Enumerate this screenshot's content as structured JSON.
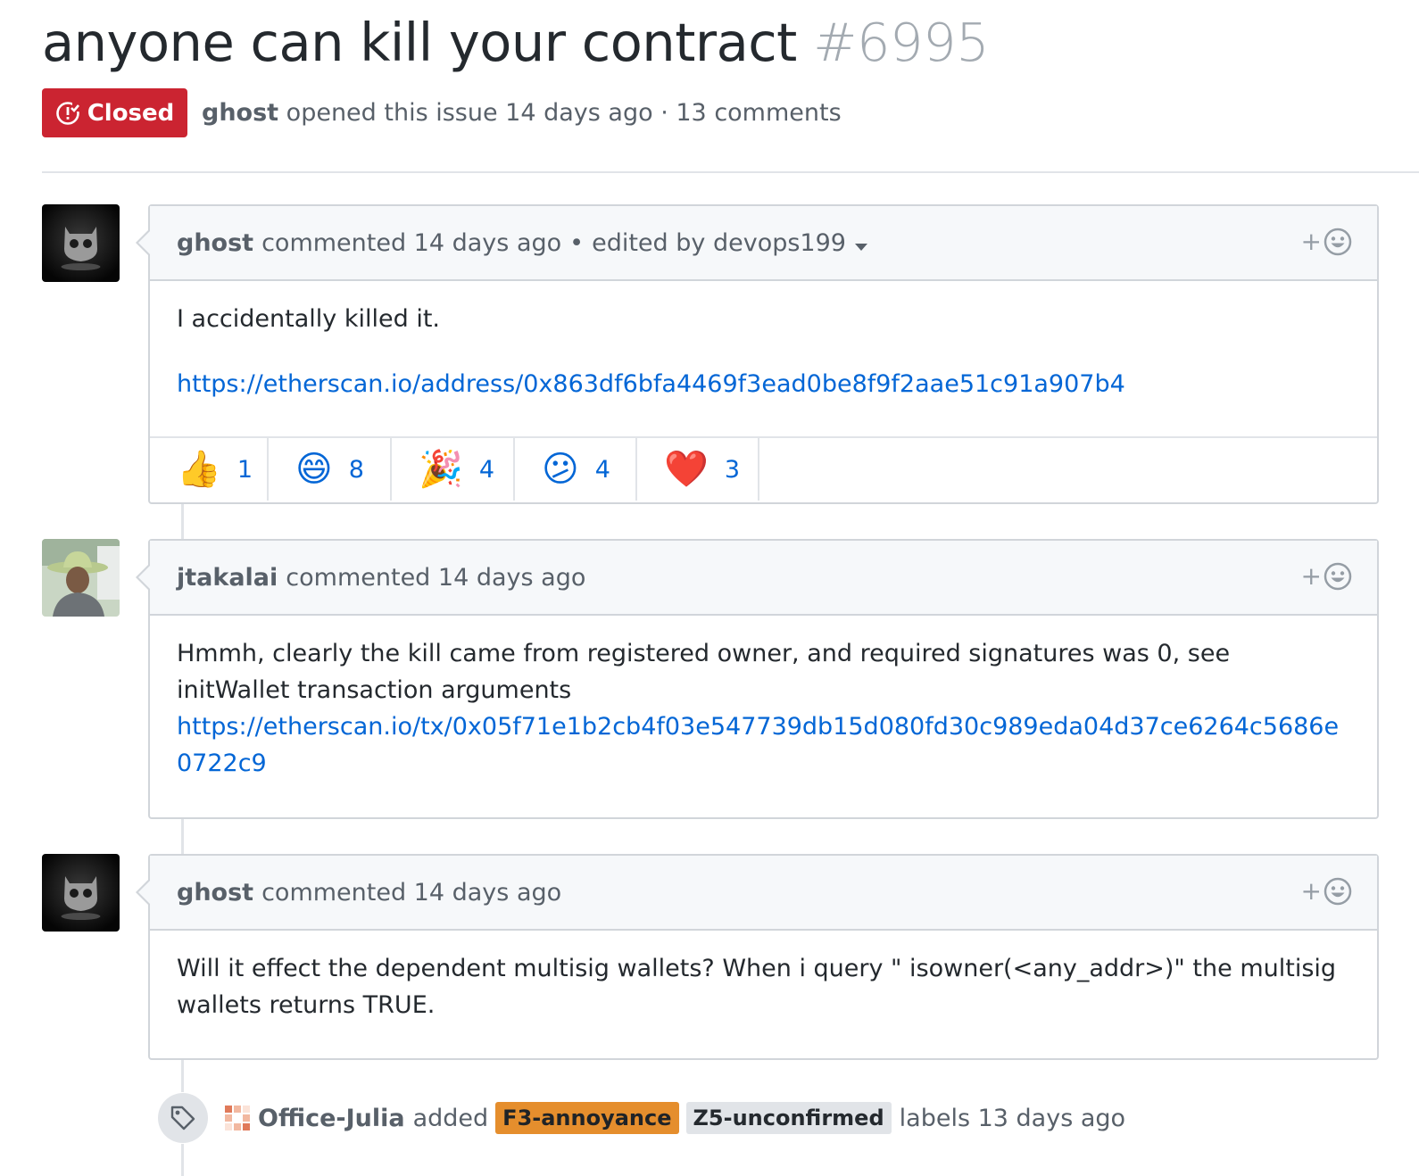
{
  "issue": {
    "title": "anyone can kill your contract",
    "number": "#6995",
    "state": "Closed",
    "author": "ghost",
    "opened_text": "opened this issue 14 days ago · 13 comments"
  },
  "comments": [
    {
      "author": "ghost",
      "meta": "commented 14 days ago",
      "edited": "edited by devops199",
      "body_text": "I accidentally killed it.",
      "link": "https://etherscan.io/address/0x863df6bfa4469f3ead0be8f9f2aae51c91a907b4",
      "reactions": [
        {
          "emoji": "👍",
          "name": "thumbs-up",
          "count": "1"
        },
        {
          "emoji": "😄",
          "name": "laugh",
          "count": "8"
        },
        {
          "emoji": "🎉",
          "name": "hooray",
          "count": "4"
        },
        {
          "emoji": "😕",
          "name": "confused",
          "count": "4"
        },
        {
          "emoji": "❤️",
          "name": "heart",
          "count": "3"
        }
      ]
    },
    {
      "author": "jtakalai",
      "meta": "commented 14 days ago",
      "body_text": "Hmmh, clearly the kill came from registered owner, and required signatures was 0, see initWallet transaction arguments",
      "link": "https://etherscan.io/tx/0x05f71e1b2cb4f03e547739db15d080fd30c989eda04d37ce6264c5686e0722c9"
    },
    {
      "author": "ghost",
      "meta": "commented 14 days ago",
      "body_text": "Will it effect the dependent multisig wallets? When i query \" isowner(<any_addr>)\" the multisig wallets returns TRUE."
    }
  ],
  "event": {
    "actor": "Office-Julia",
    "action": "added",
    "labels": [
      {
        "name": "F3-annoyance",
        "color": "#e58e2d"
      },
      {
        "name": "Z5-unconfirmed",
        "color": "#e1e4e8"
      }
    ],
    "suffix": "labels 13 days ago"
  },
  "colors": {
    "closed": "#cb2431",
    "link": "#0366d6"
  }
}
